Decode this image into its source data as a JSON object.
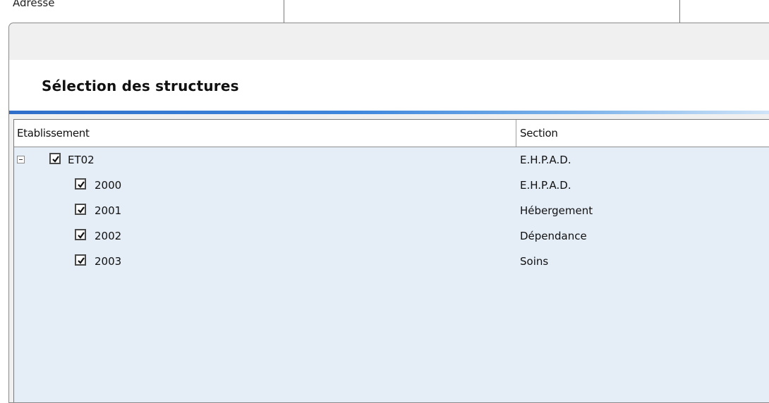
{
  "background_window": {
    "column_label": "Adresse"
  },
  "dialog": {
    "heading": "Sélection des structures",
    "accent_color": "#3f87dc"
  },
  "tree": {
    "columns": [
      "Etablissement",
      "Section"
    ],
    "rows": [
      {
        "name": "ET02",
        "section": "E.H.P.A.D.",
        "checked": true,
        "expanded": true,
        "level": 0
      },
      {
        "name": "2000",
        "section": "E.H.P.A.D.",
        "checked": true,
        "level": 1
      },
      {
        "name": "2001",
        "section": "Hébergement",
        "checked": true,
        "level": 1
      },
      {
        "name": "2002",
        "section": "Dépendance",
        "checked": true,
        "level": 1
      },
      {
        "name": "2003",
        "section": "Soins",
        "checked": true,
        "level": 1
      }
    ]
  }
}
